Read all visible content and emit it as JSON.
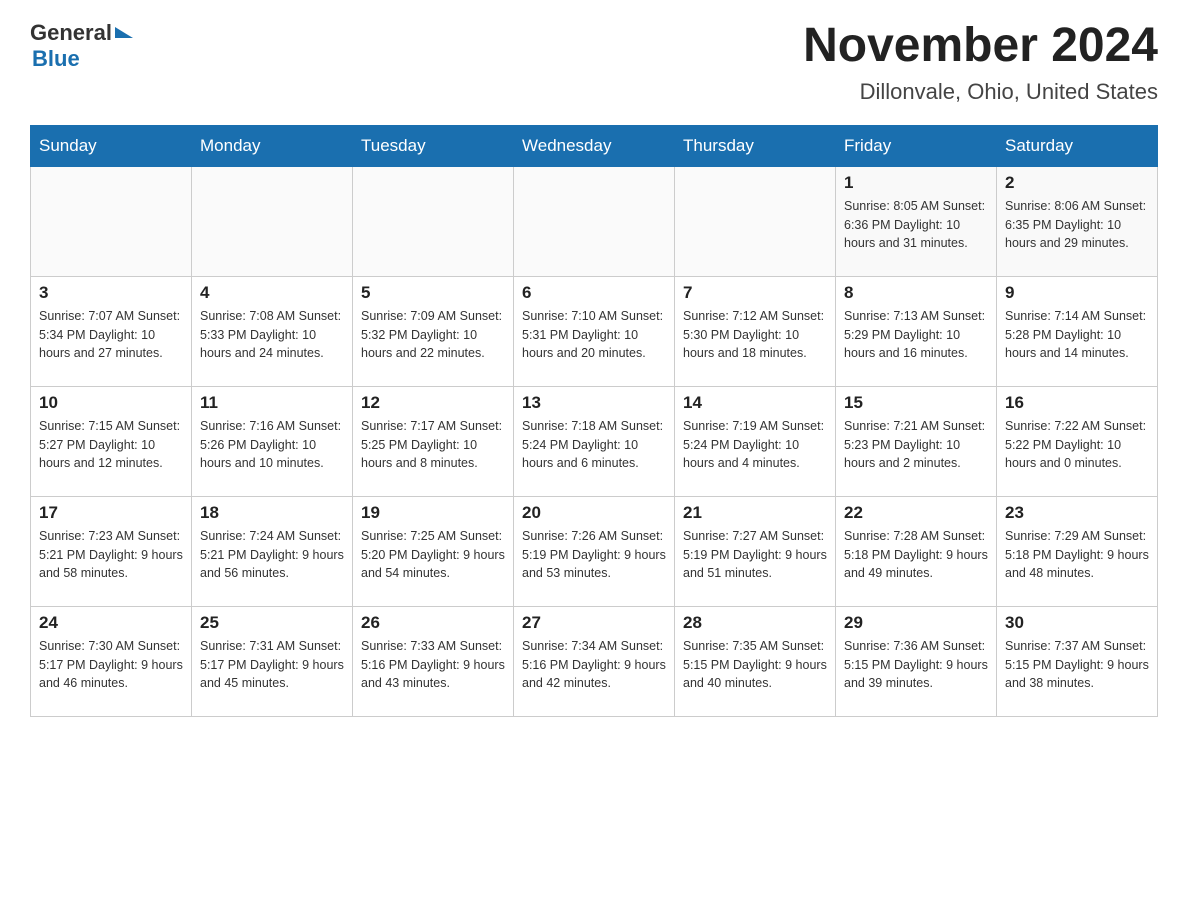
{
  "header": {
    "logo_general": "General",
    "logo_blue": "Blue",
    "month_title": "November 2024",
    "location": "Dillonvale, Ohio, United States"
  },
  "days_of_week": [
    "Sunday",
    "Monday",
    "Tuesday",
    "Wednesday",
    "Thursday",
    "Friday",
    "Saturday"
  ],
  "weeks": [
    [
      {
        "day": "",
        "info": ""
      },
      {
        "day": "",
        "info": ""
      },
      {
        "day": "",
        "info": ""
      },
      {
        "day": "",
        "info": ""
      },
      {
        "day": "",
        "info": ""
      },
      {
        "day": "1",
        "info": "Sunrise: 8:05 AM\nSunset: 6:36 PM\nDaylight: 10 hours and 31 minutes."
      },
      {
        "day": "2",
        "info": "Sunrise: 8:06 AM\nSunset: 6:35 PM\nDaylight: 10 hours and 29 minutes."
      }
    ],
    [
      {
        "day": "3",
        "info": "Sunrise: 7:07 AM\nSunset: 5:34 PM\nDaylight: 10 hours and 27 minutes."
      },
      {
        "day": "4",
        "info": "Sunrise: 7:08 AM\nSunset: 5:33 PM\nDaylight: 10 hours and 24 minutes."
      },
      {
        "day": "5",
        "info": "Sunrise: 7:09 AM\nSunset: 5:32 PM\nDaylight: 10 hours and 22 minutes."
      },
      {
        "day": "6",
        "info": "Sunrise: 7:10 AM\nSunset: 5:31 PM\nDaylight: 10 hours and 20 minutes."
      },
      {
        "day": "7",
        "info": "Sunrise: 7:12 AM\nSunset: 5:30 PM\nDaylight: 10 hours and 18 minutes."
      },
      {
        "day": "8",
        "info": "Sunrise: 7:13 AM\nSunset: 5:29 PM\nDaylight: 10 hours and 16 minutes."
      },
      {
        "day": "9",
        "info": "Sunrise: 7:14 AM\nSunset: 5:28 PM\nDaylight: 10 hours and 14 minutes."
      }
    ],
    [
      {
        "day": "10",
        "info": "Sunrise: 7:15 AM\nSunset: 5:27 PM\nDaylight: 10 hours and 12 minutes."
      },
      {
        "day": "11",
        "info": "Sunrise: 7:16 AM\nSunset: 5:26 PM\nDaylight: 10 hours and 10 minutes."
      },
      {
        "day": "12",
        "info": "Sunrise: 7:17 AM\nSunset: 5:25 PM\nDaylight: 10 hours and 8 minutes."
      },
      {
        "day": "13",
        "info": "Sunrise: 7:18 AM\nSunset: 5:24 PM\nDaylight: 10 hours and 6 minutes."
      },
      {
        "day": "14",
        "info": "Sunrise: 7:19 AM\nSunset: 5:24 PM\nDaylight: 10 hours and 4 minutes."
      },
      {
        "day": "15",
        "info": "Sunrise: 7:21 AM\nSunset: 5:23 PM\nDaylight: 10 hours and 2 minutes."
      },
      {
        "day": "16",
        "info": "Sunrise: 7:22 AM\nSunset: 5:22 PM\nDaylight: 10 hours and 0 minutes."
      }
    ],
    [
      {
        "day": "17",
        "info": "Sunrise: 7:23 AM\nSunset: 5:21 PM\nDaylight: 9 hours and 58 minutes."
      },
      {
        "day": "18",
        "info": "Sunrise: 7:24 AM\nSunset: 5:21 PM\nDaylight: 9 hours and 56 minutes."
      },
      {
        "day": "19",
        "info": "Sunrise: 7:25 AM\nSunset: 5:20 PM\nDaylight: 9 hours and 54 minutes."
      },
      {
        "day": "20",
        "info": "Sunrise: 7:26 AM\nSunset: 5:19 PM\nDaylight: 9 hours and 53 minutes."
      },
      {
        "day": "21",
        "info": "Sunrise: 7:27 AM\nSunset: 5:19 PM\nDaylight: 9 hours and 51 minutes."
      },
      {
        "day": "22",
        "info": "Sunrise: 7:28 AM\nSunset: 5:18 PM\nDaylight: 9 hours and 49 minutes."
      },
      {
        "day": "23",
        "info": "Sunrise: 7:29 AM\nSunset: 5:18 PM\nDaylight: 9 hours and 48 minutes."
      }
    ],
    [
      {
        "day": "24",
        "info": "Sunrise: 7:30 AM\nSunset: 5:17 PM\nDaylight: 9 hours and 46 minutes."
      },
      {
        "day": "25",
        "info": "Sunrise: 7:31 AM\nSunset: 5:17 PM\nDaylight: 9 hours and 45 minutes."
      },
      {
        "day": "26",
        "info": "Sunrise: 7:33 AM\nSunset: 5:16 PM\nDaylight: 9 hours and 43 minutes."
      },
      {
        "day": "27",
        "info": "Sunrise: 7:34 AM\nSunset: 5:16 PM\nDaylight: 9 hours and 42 minutes."
      },
      {
        "day": "28",
        "info": "Sunrise: 7:35 AM\nSunset: 5:15 PM\nDaylight: 9 hours and 40 minutes."
      },
      {
        "day": "29",
        "info": "Sunrise: 7:36 AM\nSunset: 5:15 PM\nDaylight: 9 hours and 39 minutes."
      },
      {
        "day": "30",
        "info": "Sunrise: 7:37 AM\nSunset: 5:15 PM\nDaylight: 9 hours and 38 minutes."
      }
    ]
  ]
}
